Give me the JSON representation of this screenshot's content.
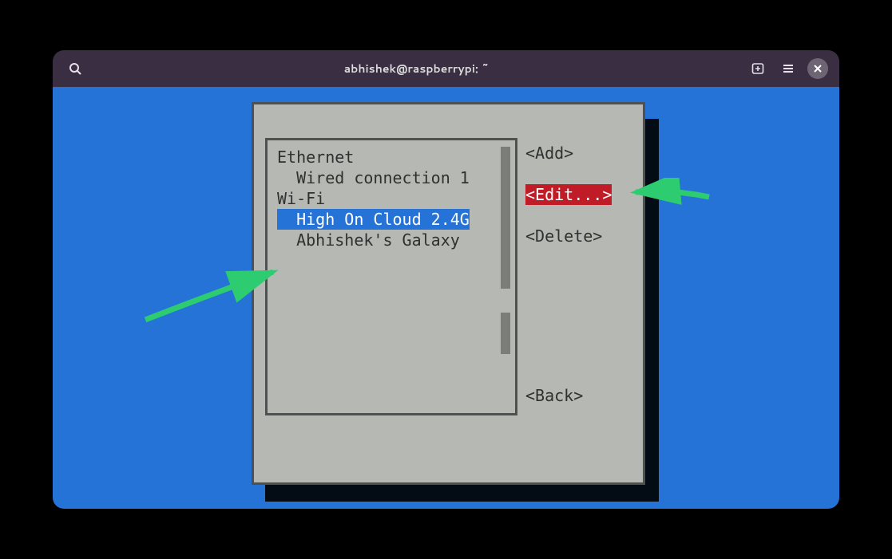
{
  "window": {
    "title": "abhishek@raspberrypi: ~"
  },
  "connections": {
    "ethernet_label": "Ethernet",
    "wifi_label": "Wi-Fi",
    "ethernet_items": [
      "  Wired connection 1"
    ],
    "wifi_items": [
      {
        "label": "  High On Cloud 2.4G",
        "selected": true
      },
      {
        "label": "  Abhishek's Galaxy",
        "selected": false
      }
    ]
  },
  "actions": {
    "add": "<Add>",
    "edit": "<Edit...>",
    "delete": "<Delete>",
    "back": "<Back>"
  }
}
